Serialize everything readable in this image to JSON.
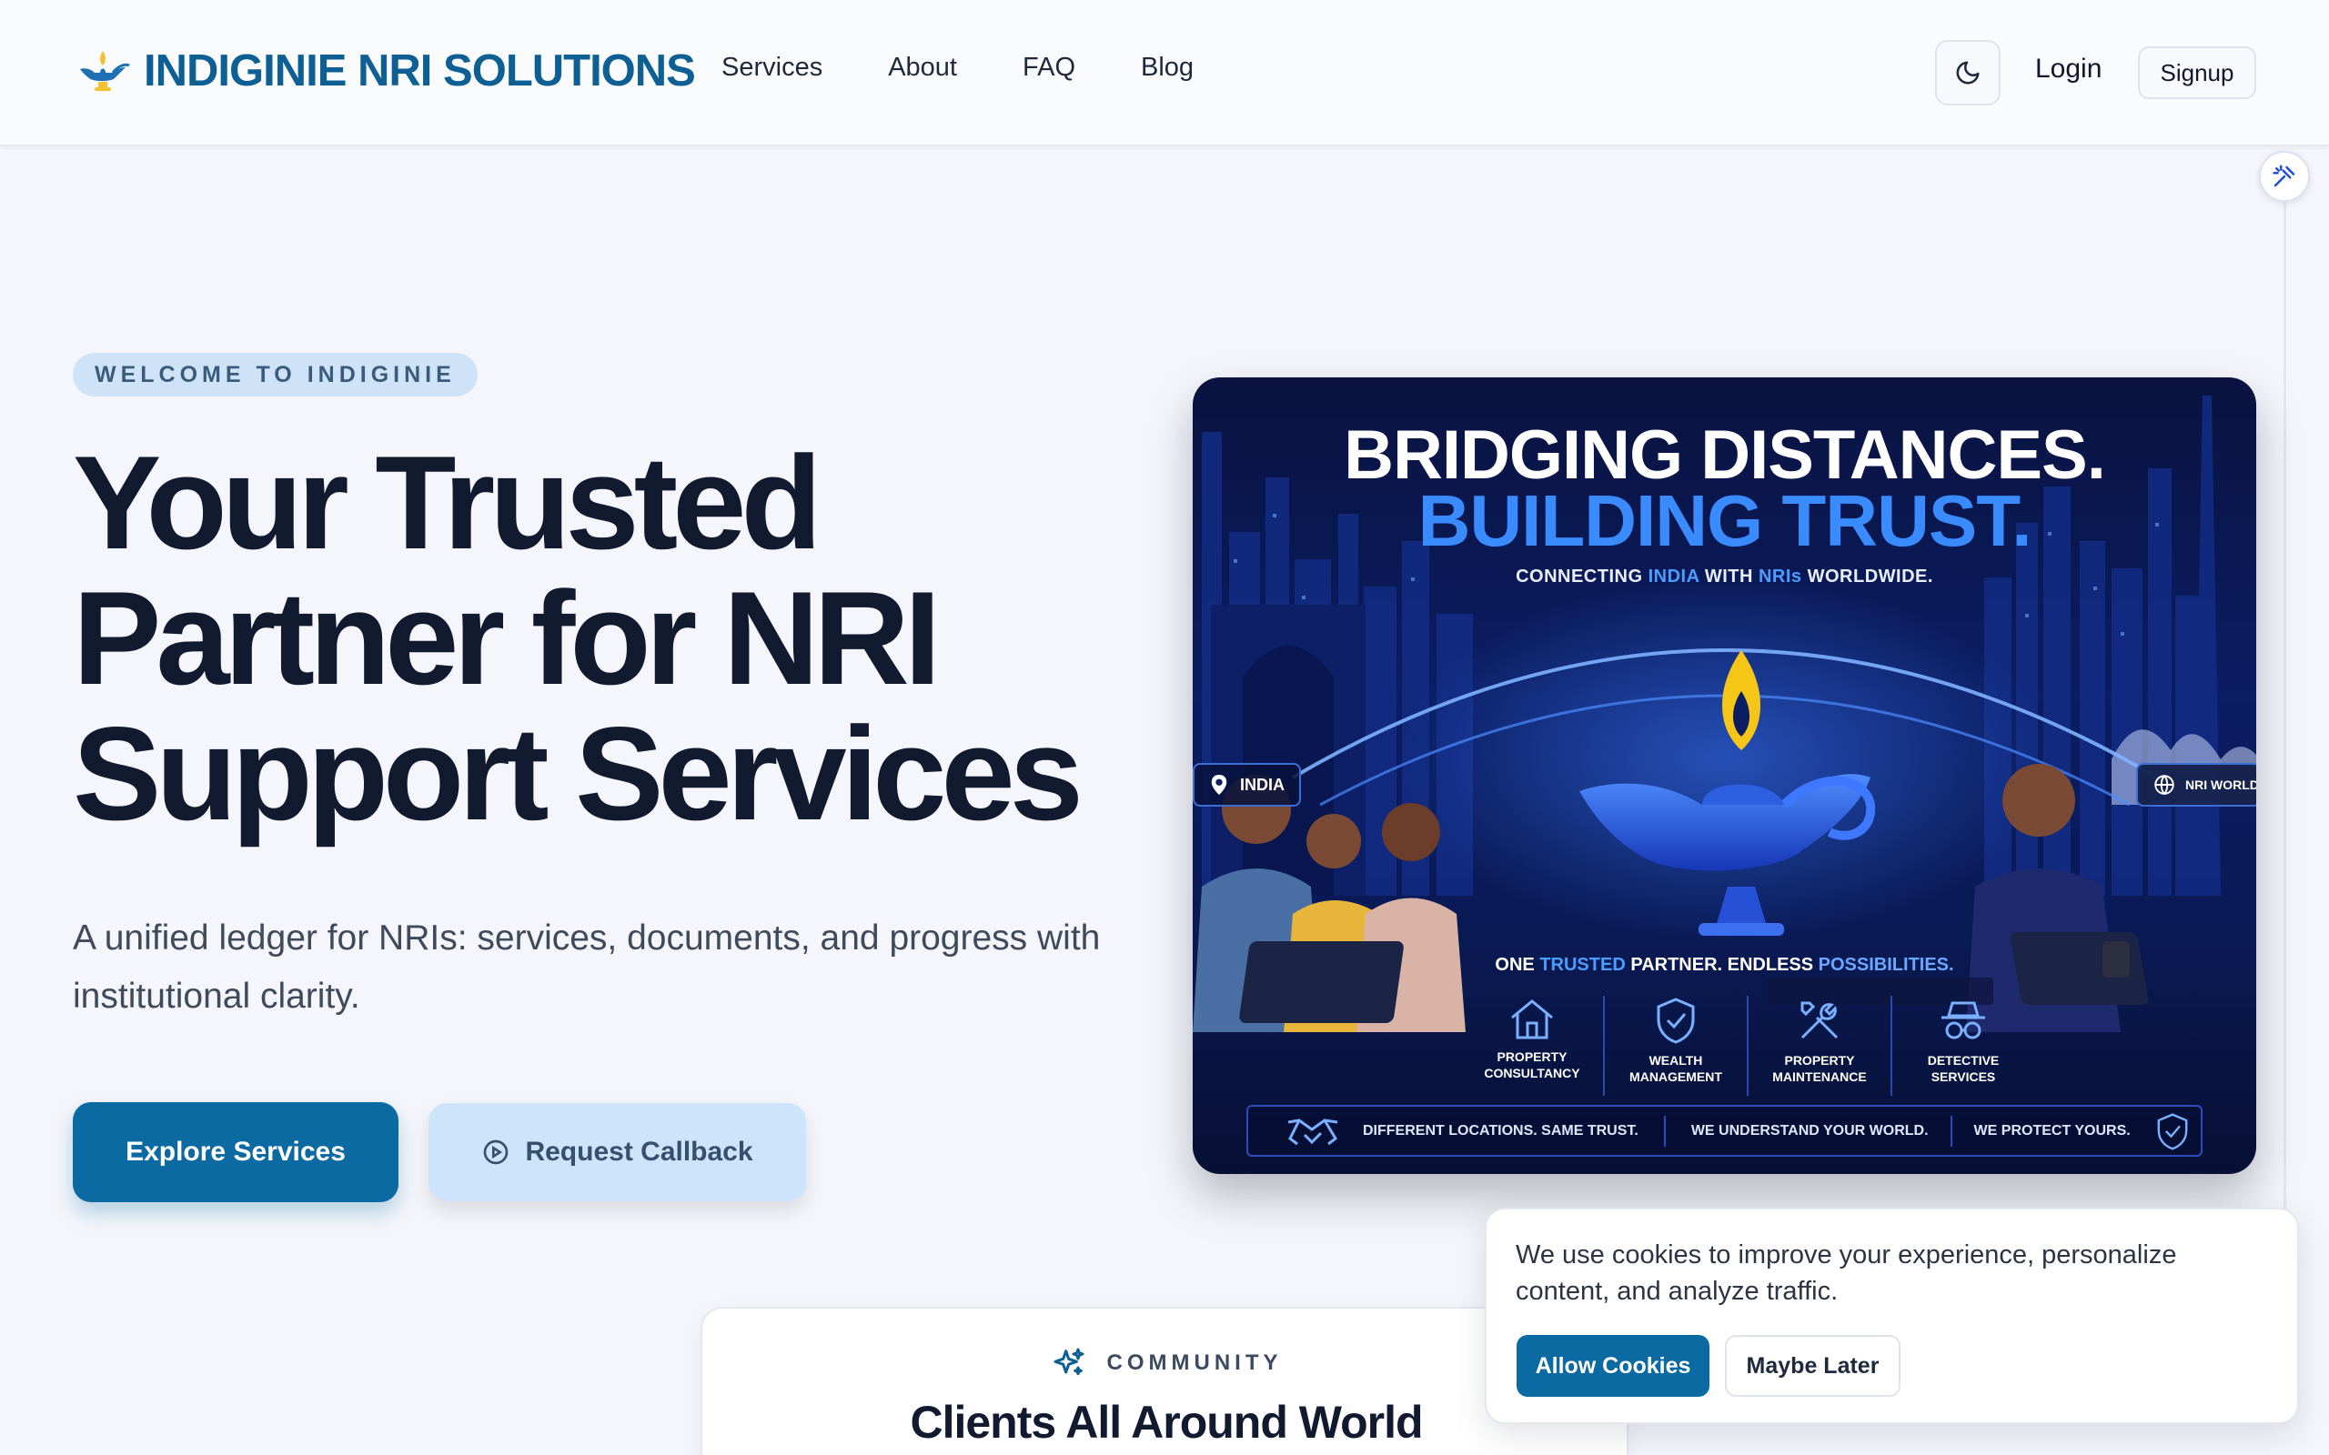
{
  "brand": {
    "name": "INDIGINIE NRI SOLUTIONS",
    "logo_icon": "magic-lamp-icon"
  },
  "nav": {
    "items": [
      "Services",
      "About",
      "FAQ",
      "Blog"
    ]
  },
  "header": {
    "theme_icon": "moon-icon",
    "login_label": "Login",
    "signup_label": "Signup"
  },
  "accessibility": {
    "icon": "accessibility-icon"
  },
  "hero": {
    "eyebrow": "WELCOME TO INDIGINIE",
    "title_lines": [
      "Your Trusted",
      "Partner for NRI",
      "Support Services"
    ],
    "subtitle": "A unified ledger for NRIs: services, documents, and progress with institutional clarity.",
    "primary_cta": "Explore Services",
    "secondary_cta": "Request Callback",
    "secondary_icon": "play-circle-icon"
  },
  "banner": {
    "title_line1": "BRIDGING DISTANCES.",
    "title_line2": "BUILDING TRUST.",
    "tagline_parts": [
      "CONNECTING ",
      "INDIA",
      " WITH ",
      "NRIs",
      " WORLDWIDE."
    ],
    "chip_left": "INDIA",
    "chip_right": "NRI WORLD",
    "partner_parts": [
      "ONE ",
      "TRUSTED",
      " PARTNER. ENDLESS ",
      "POSSIBILITIES."
    ],
    "services": [
      {
        "label_line1": "PROPERTY",
        "label_line2": "CONSULTANCY",
        "icon": "house-icon"
      },
      {
        "label_line1": "WEALTH",
        "label_line2": "MANAGEMENT",
        "icon": "shield-check-icon"
      },
      {
        "label_line1": "PROPERTY",
        "label_line2": "MAINTENANCE",
        "icon": "tools-icon"
      },
      {
        "label_line1": "DETECTIVE",
        "label_line2": "SERVICES",
        "icon": "detective-icon"
      }
    ],
    "bar_items": [
      "DIFFERENT LOCATIONS. SAME TRUST.",
      "WE UNDERSTAND YOUR WORLD.",
      "WE PROTECT YOURS."
    ],
    "colors": {
      "accent": "#3a8bff",
      "lamp": "#f5c518"
    }
  },
  "community": {
    "eyebrow": "COMMUNITY",
    "title": "Clients All Around World",
    "icon": "sparkles-icon"
  },
  "cookie": {
    "message": "We use cookies to improve your experience, personalize content, and analyze traffic.",
    "allow_label": "Allow Cookies",
    "later_label": "Maybe Later"
  },
  "colors": {
    "brand": "#0e5f93",
    "primary_button": "#0c6aa3",
    "secondary_button": "#cde4fb",
    "background": "#f5f6fb"
  }
}
